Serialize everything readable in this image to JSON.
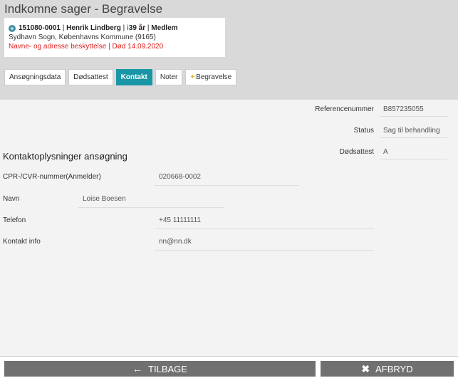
{
  "header": {
    "title": "Indkomne sager - Begravelse",
    "case": {
      "id": "151080-0001",
      "sep1": "|",
      "name": "Henrik Lindberg",
      "sep2": "|",
      "person_icon": "i",
      "age": "39 år",
      "sep3": "|",
      "membership": "Medlem",
      "address": "Sydhavn Sogn, Københavns Kommune (9165)",
      "warning": "Navne- og adresse beskyttelse | Død 14.09.2020"
    }
  },
  "tabs": [
    {
      "label": "Ansøgningsdata"
    },
    {
      "label": "Dødsattest"
    },
    {
      "label": "Kontakt"
    },
    {
      "label": "Noter"
    },
    {
      "label": "Begravelse",
      "icon": "+"
    }
  ],
  "info": {
    "reference_label": "Referencenummer",
    "reference_value": "B857235055",
    "status_label": "Status",
    "status_value": "Sag til behandling",
    "death_cert_label": "Dødsattest",
    "death_cert_value": "A"
  },
  "contact": {
    "section_title": "Kontaktoplysninger ansøgning",
    "cpr_label": "CPR-/CVR-nummer(Anmelder)",
    "cpr_value": "020668-0002",
    "name_label": "Navn",
    "name_value": "Loise Boesen",
    "phone_label": "Telefon",
    "phone_value": "+45 11111111",
    "info_label": "Kontakt info",
    "info_value": "nn@nn.dk"
  },
  "footer": {
    "back_label": "TILBAGE",
    "back_icon": "←",
    "cancel_label": "AFBRYD",
    "cancel_icon": "✖"
  },
  "colors": {
    "accent": "#1996a6",
    "warning": "#e02020",
    "button": "#707070"
  }
}
